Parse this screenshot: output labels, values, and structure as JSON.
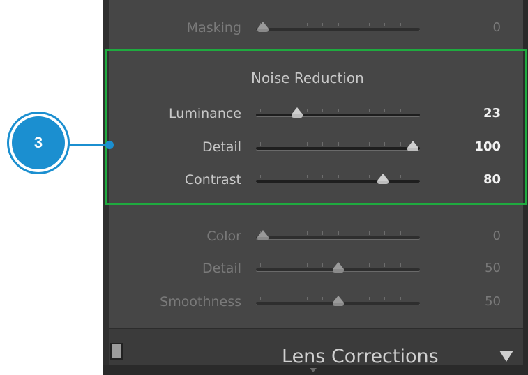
{
  "callout": {
    "number": "3",
    "color": "#1b8fd0"
  },
  "highlight_color": "#1faa3f",
  "sharpening": {
    "masking": {
      "label": "Masking",
      "value": "0",
      "position": 0.0
    }
  },
  "noise_reduction": {
    "title": "Noise Reduction",
    "luminance": {
      "label": "Luminance",
      "value": "23",
      "position": 0.23
    },
    "detail": {
      "label": "Detail",
      "value": "100",
      "position": 1.0
    },
    "contrast": {
      "label": "Contrast",
      "value": "80",
      "position": 0.8
    },
    "color": {
      "label": "Color",
      "value": "0",
      "position": 0.0
    },
    "color_detail": {
      "label": "Detail",
      "value": "50",
      "position": 0.5
    },
    "smoothness": {
      "label": "Smoothness",
      "value": "50",
      "position": 0.5
    }
  },
  "lens_corrections": {
    "title": "Lens Corrections",
    "icon": "triangle-down-icon"
  }
}
